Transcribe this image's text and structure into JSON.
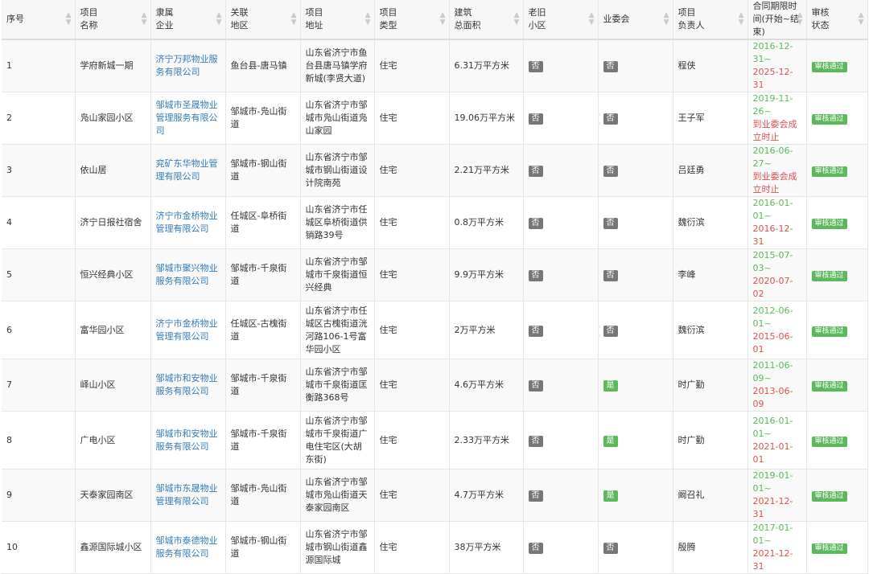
{
  "headers": [
    {
      "key": "no",
      "lines": [
        "序号"
      ]
    },
    {
      "key": "name",
      "lines": [
        "项目",
        "名称"
      ]
    },
    {
      "key": "company",
      "lines": [
        "隶属",
        "企业"
      ]
    },
    {
      "key": "district",
      "lines": [
        "关联",
        "地区"
      ]
    },
    {
      "key": "address",
      "lines": [
        "项目",
        "地址"
      ]
    },
    {
      "key": "type",
      "lines": [
        "项目",
        "类型"
      ]
    },
    {
      "key": "area",
      "lines": [
        "建筑",
        "总面积"
      ]
    },
    {
      "key": "old",
      "lines": [
        "老旧",
        "小区"
      ]
    },
    {
      "key": "committee",
      "lines": [
        "业委会"
      ]
    },
    {
      "key": "manager",
      "lines": [
        "项目",
        "负责人"
      ]
    },
    {
      "key": "period",
      "lines": [
        "合同期限时",
        "间(开始~结束)"
      ]
    },
    {
      "key": "review",
      "lines": [
        "审核",
        "状态"
      ]
    }
  ],
  "rows": [
    {
      "no": "1",
      "name": "学府新城一期",
      "company": "济宁万邦物业服务有限公司",
      "district": "鱼台县-唐马镇",
      "address": "山东省济宁市鱼台县唐马镇学府新城(李贤大道)",
      "type": "住宅",
      "area": "6.31万平方米",
      "old": "否",
      "committee": "否",
      "manager": "程侠",
      "period_start": "2016-12-31~",
      "period_end": "2025-12-31",
      "review": "审核通过"
    },
    {
      "no": "2",
      "name": "凫山家园小区",
      "company": "邹城市圣晟物业管理服务有限公司",
      "district": "邹城市-凫山街道",
      "address": "山东省济宁市邹城市凫山街道凫山家园",
      "type": "住宅",
      "area": "19.06万平方米",
      "old": "否",
      "committee": "否",
      "manager": "王子军",
      "period_start": "2019-11-26~",
      "period_end": "到业委会成立时止",
      "review": "审核通过"
    },
    {
      "no": "3",
      "name": "依山居",
      "company": "兖矿东华物业管理有限公司",
      "district": "邹城市-钢山街道",
      "address": "山东省济宁市邹城市钢山街道设计院南苑",
      "type": "住宅",
      "area": "2.21万平方米",
      "old": "否",
      "committee": "否",
      "manager": "吕廷勇",
      "period_start": "2016-06-27~",
      "period_end": "到业委会成立时止",
      "review": "审核通过"
    },
    {
      "no": "4",
      "name": "济宁日报社宿舍",
      "company": "济宁市金桥物业管理有限公司",
      "district": "任城区-阜桥街道",
      "address": "山东省济宁市任城区阜桥街道供销路39号",
      "type": "住宅",
      "area": "0.8万平方米",
      "old": "否",
      "committee": "否",
      "manager": "魏衍滨",
      "period_start": "2016-01-01~",
      "period_end": "2016-12-31",
      "review": "审核通过"
    },
    {
      "no": "5",
      "name": "恒兴经典小区",
      "company": "邹城市聚兴物业服务有限公司",
      "district": "邹城市-千泉街道",
      "address": "山东省济宁市邹城市千泉街道恒兴经典",
      "type": "住宅",
      "area": "9.9万平方米",
      "old": "否",
      "committee": "否",
      "manager": "李峰",
      "period_start": "2015-07-03~",
      "period_end": "2020-07-02",
      "review": "审核通过"
    },
    {
      "no": "6",
      "name": "富华园小区",
      "company": "济宁市金桥物业管理有限公司",
      "district": "任城区-古槐街道",
      "address": "山东省济宁市任城区古槐街道洸河路106-1号富华园小区",
      "type": "住宅",
      "area": "2万平方米",
      "old": "否",
      "committee": "否",
      "manager": "魏衍滨",
      "period_start": "2012-06-01~",
      "period_end": "2015-06-01",
      "review": "审核通过"
    },
    {
      "no": "7",
      "name": "峄山小区",
      "company": "邹城市和安物业服务有限公司",
      "district": "邹城市-千泉街道",
      "address": "山东省济宁市邹城市千泉街道匡衡路368号",
      "type": "住宅",
      "area": "4.6万平方米",
      "old": "否",
      "committee": "是",
      "manager": "时广勤",
      "period_start": "2011-06-09~",
      "period_end": "2013-06-09",
      "review": "审核通过"
    },
    {
      "no": "8",
      "name": "广电小区",
      "company": "邹城市和安物业服务有限公司",
      "district": "邹城市-千泉街道",
      "address": "山东省济宁市邹城市千泉街道广电住宅区(大胡东街)",
      "type": "住宅",
      "area": "2.33万平方米",
      "old": "否",
      "committee": "是",
      "manager": "时广勤",
      "period_start": "2016-01-01~",
      "period_end": "2021-01-01",
      "review": "审核通过"
    },
    {
      "no": "9",
      "name": "天泰家园南区",
      "company": "邹城市东晟物业管理有限公司",
      "district": "邹城市-凫山街道",
      "address": "山东省济宁市邹城市凫山街道天泰家园南区",
      "type": "住宅",
      "area": "4.7万平方米",
      "old": "否",
      "committee": "是",
      "manager": "阚召礼",
      "period_start": "2019-01-01~",
      "period_end": "2021-12-31",
      "review": "审核通过"
    },
    {
      "no": "10",
      "name": "鑫源国际城小区",
      "company": "邹城市泰德物业服务有限公司",
      "district": "邹城市-钢山街道",
      "address": "山东省济宁市邹城市钢山街道鑫源国际城",
      "type": "住宅",
      "area": "38万平方米",
      "old": "否",
      "committee": "否",
      "manager": "殷腾",
      "period_start": "2017-01-01~",
      "period_end": "2021-12-31",
      "review": "审核通过"
    }
  ],
  "colors": {
    "link": "#337ab7",
    "green": "#5cb85c",
    "red": "#d9534f",
    "grey_tag": "#777777"
  }
}
